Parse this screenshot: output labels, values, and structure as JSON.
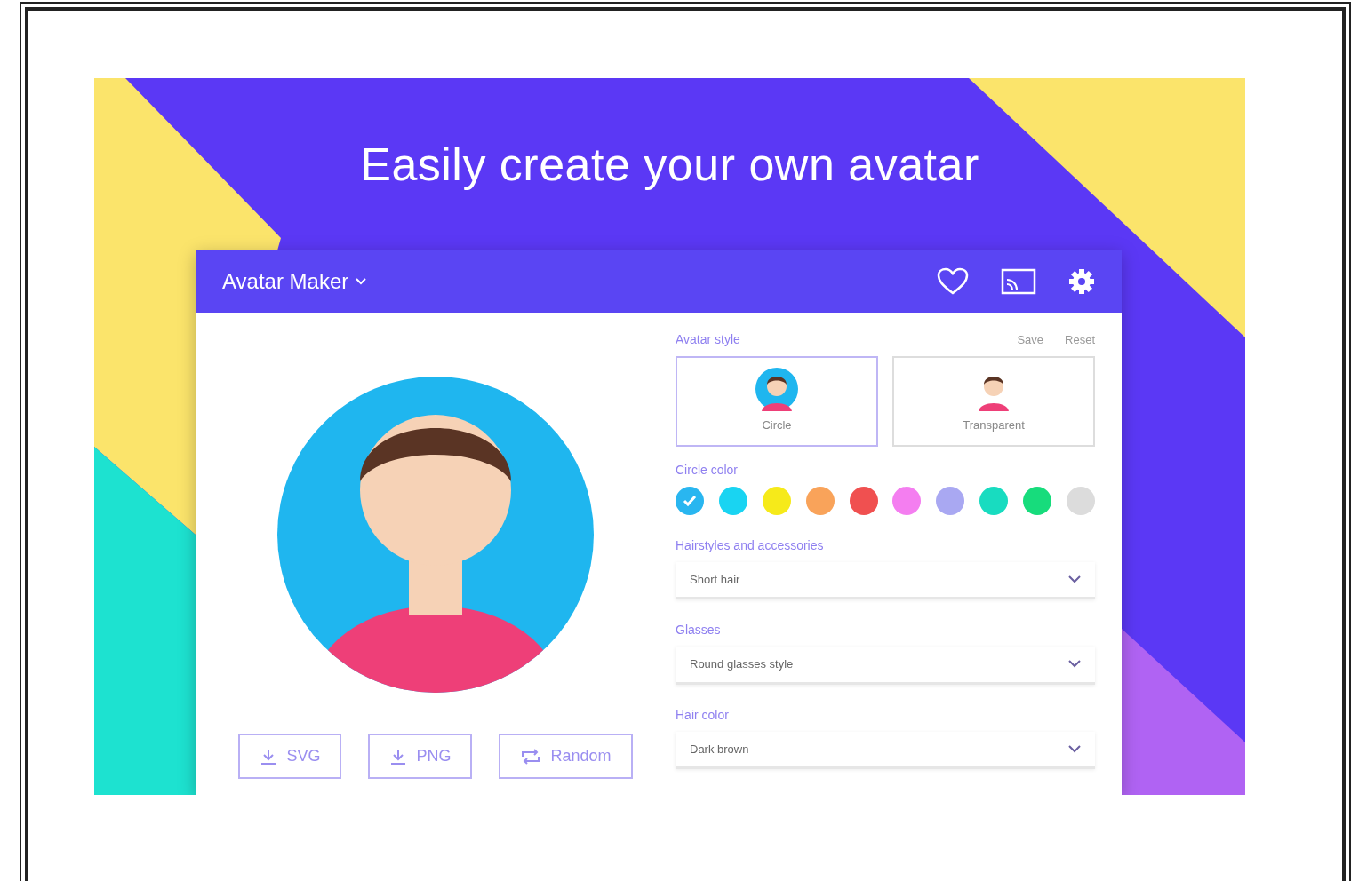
{
  "banner": {
    "headline": "Easily create your own avatar"
  },
  "window": {
    "title": "Avatar Maker"
  },
  "avatar_style": {
    "label": "Avatar style",
    "actions": [
      "Save",
      "Reset"
    ],
    "options": [
      {
        "label": "Circle",
        "kind": "circle",
        "selected": true
      },
      {
        "label": "Transparent",
        "kind": "transparent",
        "selected": false
      }
    ]
  },
  "circle_color": {
    "label": "Circle color",
    "swatches": [
      {
        "color": "#29b6f0",
        "selected": true
      },
      {
        "color": "#19d4f2",
        "selected": false
      },
      {
        "color": "#f6ea1a",
        "selected": false
      },
      {
        "color": "#f9a35a",
        "selected": false
      },
      {
        "color": "#f05050",
        "selected": false
      },
      {
        "color": "#f47ef0",
        "selected": false
      },
      {
        "color": "#a9a8f2",
        "selected": false
      },
      {
        "color": "#18dcc0",
        "selected": false
      },
      {
        "color": "#17dc7c",
        "selected": false
      },
      {
        "color": "#dcdcdc",
        "selected": false
      }
    ]
  },
  "selects": [
    {
      "label": "Hairstyles and accessories",
      "value": "Short hair"
    },
    {
      "label": "Glasses",
      "value": "Round glasses style"
    },
    {
      "label": "Hair color",
      "value": "Dark brown"
    }
  ],
  "buttons": [
    {
      "label": "SVG",
      "kind": "download"
    },
    {
      "label": "PNG",
      "kind": "download"
    },
    {
      "label": "Random",
      "kind": "shuffle"
    }
  ]
}
